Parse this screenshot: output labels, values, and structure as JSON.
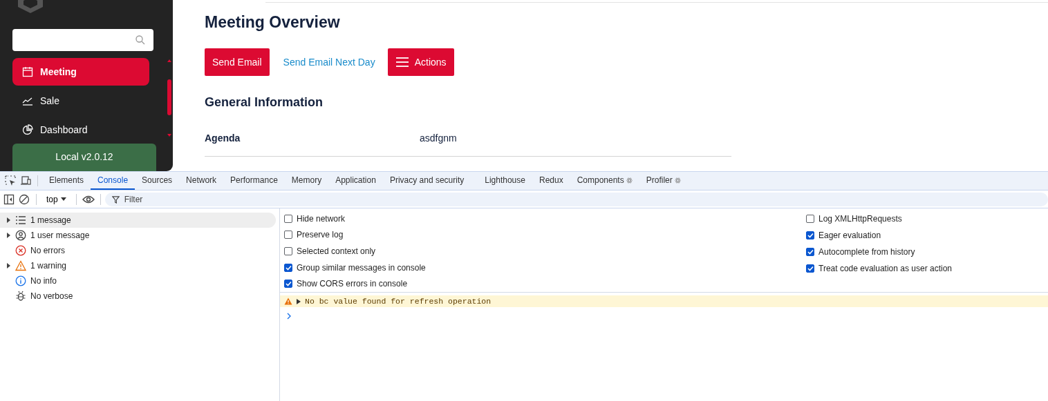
{
  "sidebar": {
    "items": [
      {
        "label": "Meeting",
        "selected": true
      },
      {
        "label": "Sale",
        "selected": false
      },
      {
        "label": "Dashboard",
        "selected": false
      }
    ],
    "version_badge": "Local v2.0.12"
  },
  "main": {
    "title": "Meeting Overview",
    "buttons": [
      {
        "label": "Send Email",
        "kind": "primary"
      },
      {
        "label": "Send Email Next Day",
        "kind": "link"
      },
      {
        "label": "Actions",
        "kind": "menu"
      }
    ],
    "section_title": "General Information",
    "fields": [
      {
        "label": "Agenda",
        "value": "asdfgnm"
      }
    ]
  },
  "devtools": {
    "tabs": [
      {
        "label": "Elements",
        "selected": false,
        "kind": "builtin"
      },
      {
        "label": "Console",
        "selected": true,
        "kind": "builtin"
      },
      {
        "label": "Sources",
        "selected": false,
        "kind": "builtin"
      },
      {
        "label": "Network",
        "selected": false,
        "kind": "builtin"
      },
      {
        "label": "Performance",
        "selected": false,
        "kind": "builtin"
      },
      {
        "label": "Memory",
        "selected": false,
        "kind": "builtin"
      },
      {
        "label": "Application",
        "selected": false,
        "kind": "builtin"
      },
      {
        "label": "Privacy and security",
        "selected": false,
        "kind": "builtin"
      },
      {
        "label": "Lighthouse",
        "selected": false,
        "kind": "builtin"
      },
      {
        "label": "Redux",
        "selected": false,
        "kind": "builtin"
      },
      {
        "label": "Components",
        "selected": false,
        "kind": "extension"
      },
      {
        "label": "Profiler",
        "selected": false,
        "kind": "extension"
      }
    ],
    "context": "top",
    "filter": {
      "placeholder": "Filter"
    },
    "filters": [
      {
        "label": "1 message",
        "expandable": true,
        "selected": true
      },
      {
        "label": "1 user message",
        "expandable": true,
        "selected": false
      },
      {
        "label": "No errors",
        "expandable": false,
        "selected": false
      },
      {
        "label": "1 warning",
        "expandable": true,
        "selected": false
      },
      {
        "label": "No info",
        "expandable": false,
        "selected": false
      },
      {
        "label": "No verbose",
        "expandable": false,
        "selected": false
      }
    ],
    "settings_left": [
      {
        "label": "Hide network",
        "checked": false
      },
      {
        "label": "Preserve log",
        "checked": false
      },
      {
        "label": "Selected context only",
        "checked": false
      },
      {
        "label": "Group similar messages in console",
        "checked": true
      },
      {
        "label": "Show CORS errors in console",
        "checked": true
      }
    ],
    "settings_right": [
      {
        "label": "Log XMLHttpRequests",
        "checked": false
      },
      {
        "label": "Eager evaluation",
        "checked": true
      },
      {
        "label": "Autocomplete from history",
        "checked": true
      },
      {
        "label": "Treat code evaluation as user action",
        "checked": true
      }
    ],
    "messages": [
      {
        "kind": "warning",
        "text": "No bc value found for refresh operation",
        "expanded": false
      }
    ]
  }
}
